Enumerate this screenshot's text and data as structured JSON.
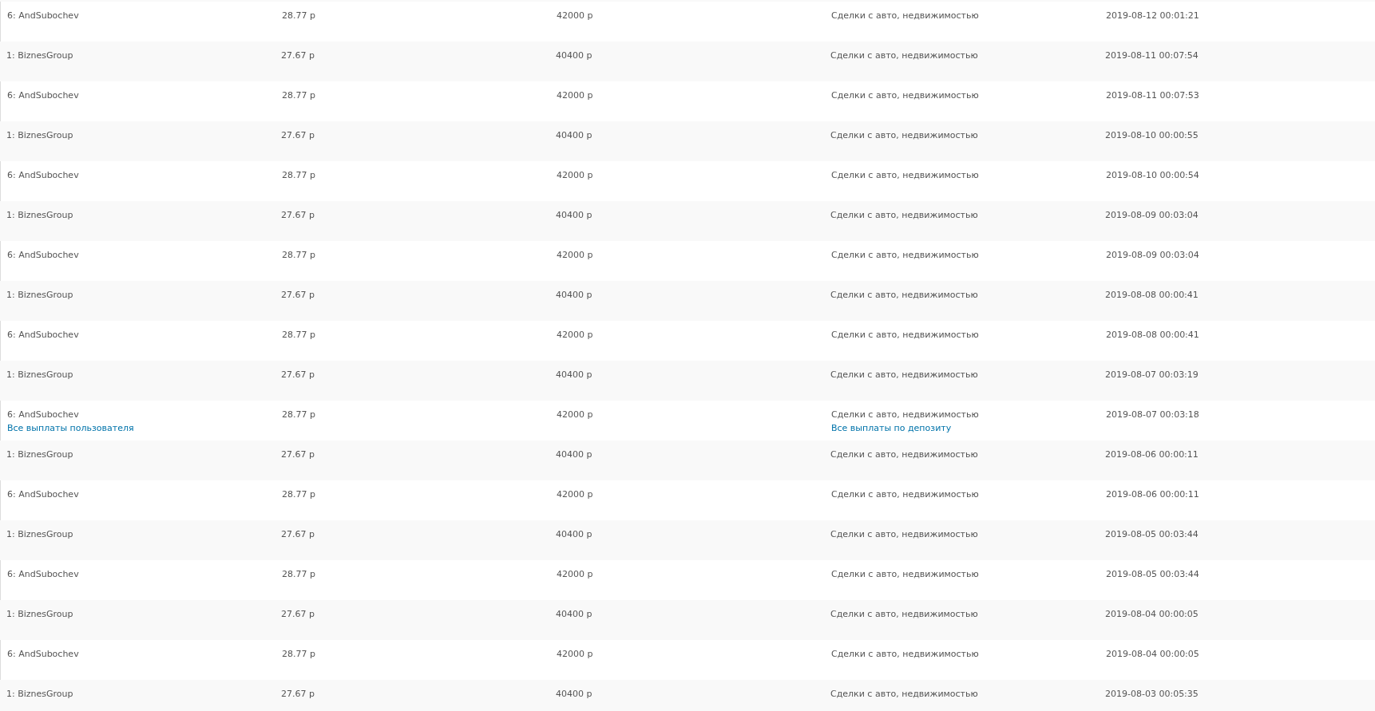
{
  "table": {
    "rows": [
      {
        "user": "6: AndSubochev",
        "rate": "28.77 р",
        "amount": "42000 р",
        "deposit": "Сделки с авто, недвижимостью",
        "date": "2019-08-12 00:01:21"
      },
      {
        "user": "1: BiznesGroup",
        "rate": "27.67 р",
        "amount": "40400 р",
        "deposit": "Сделки с авто, недвижимостью",
        "date": "2019-08-11 00:07:54"
      },
      {
        "user": "6: AndSubochev",
        "rate": "28.77 р",
        "amount": "42000 р",
        "deposit": "Сделки с авто, недвижимостью",
        "date": "2019-08-11 00:07:53"
      },
      {
        "user": "1: BiznesGroup",
        "rate": "27.67 р",
        "amount": "40400 р",
        "deposit": "Сделки с авто, недвижимостью",
        "date": "2019-08-10 00:00:55"
      },
      {
        "user": "6: AndSubochev",
        "rate": "28.77 р",
        "amount": "42000 р",
        "deposit": "Сделки с авто, недвижимостью",
        "date": "2019-08-10 00:00:54"
      },
      {
        "user": "1: BiznesGroup",
        "rate": "27.67 р",
        "amount": "40400 р",
        "deposit": "Сделки с авто, недвижимостью",
        "date": "2019-08-09 00:03:04"
      },
      {
        "user": "6: AndSubochev",
        "rate": "28.77 р",
        "amount": "42000 р",
        "deposit": "Сделки с авто, недвижимостью",
        "date": "2019-08-09 00:03:04"
      },
      {
        "user": "1: BiznesGroup",
        "rate": "27.67 р",
        "amount": "40400 р",
        "deposit": "Сделки с авто, недвижимостью",
        "date": "2019-08-08 00:00:41"
      },
      {
        "user": "6: AndSubochev",
        "rate": "28.77 р",
        "amount": "42000 р",
        "deposit": "Сделки с авто, недвижимостью",
        "date": "2019-08-08 00:00:41"
      },
      {
        "user": "1: BiznesGroup",
        "rate": "27.67 р",
        "amount": "40400 р",
        "deposit": "Сделки с авто, недвижимостью",
        "date": "2019-08-07 00:03:19"
      },
      {
        "user": "6: AndSubochev",
        "rate": "28.77 р",
        "amount": "42000 р",
        "deposit": "Сделки с авто, недвижимостью",
        "date": "2019-08-07 00:03:18",
        "user_link": "Все выплаты пользователя",
        "deposit_link": "Все выплаты по депозиту"
      },
      {
        "user": "1: BiznesGroup",
        "rate": "27.67 р",
        "amount": "40400 р",
        "deposit": "Сделки с авто, недвижимостью",
        "date": "2019-08-06 00:00:11"
      },
      {
        "user": "6: AndSubochev",
        "rate": "28.77 р",
        "amount": "42000 р",
        "deposit": "Сделки с авто, недвижимостью",
        "date": "2019-08-06 00:00:11"
      },
      {
        "user": "1: BiznesGroup",
        "rate": "27.67 р",
        "amount": "40400 р",
        "deposit": "Сделки с авто, недвижимостью",
        "date": "2019-08-05 00:03:44"
      },
      {
        "user": "6: AndSubochev",
        "rate": "28.77 р",
        "amount": "42000 р",
        "deposit": "Сделки с авто, недвижимостью",
        "date": "2019-08-05 00:03:44"
      },
      {
        "user": "1: BiznesGroup",
        "rate": "27.67 р",
        "amount": "40400 р",
        "deposit": "Сделки с авто, недвижимостью",
        "date": "2019-08-04 00:00:05"
      },
      {
        "user": "6: AndSubochev",
        "rate": "28.77 р",
        "amount": "42000 р",
        "deposit": "Сделки с авто, недвижимостью",
        "date": "2019-08-04 00:00:05"
      },
      {
        "user": "1: BiznesGroup",
        "rate": "27.67 р",
        "amount": "40400 р",
        "deposit": "Сделки с авто, недвижимостью",
        "date": "2019-08-03 00:05:35"
      }
    ]
  }
}
